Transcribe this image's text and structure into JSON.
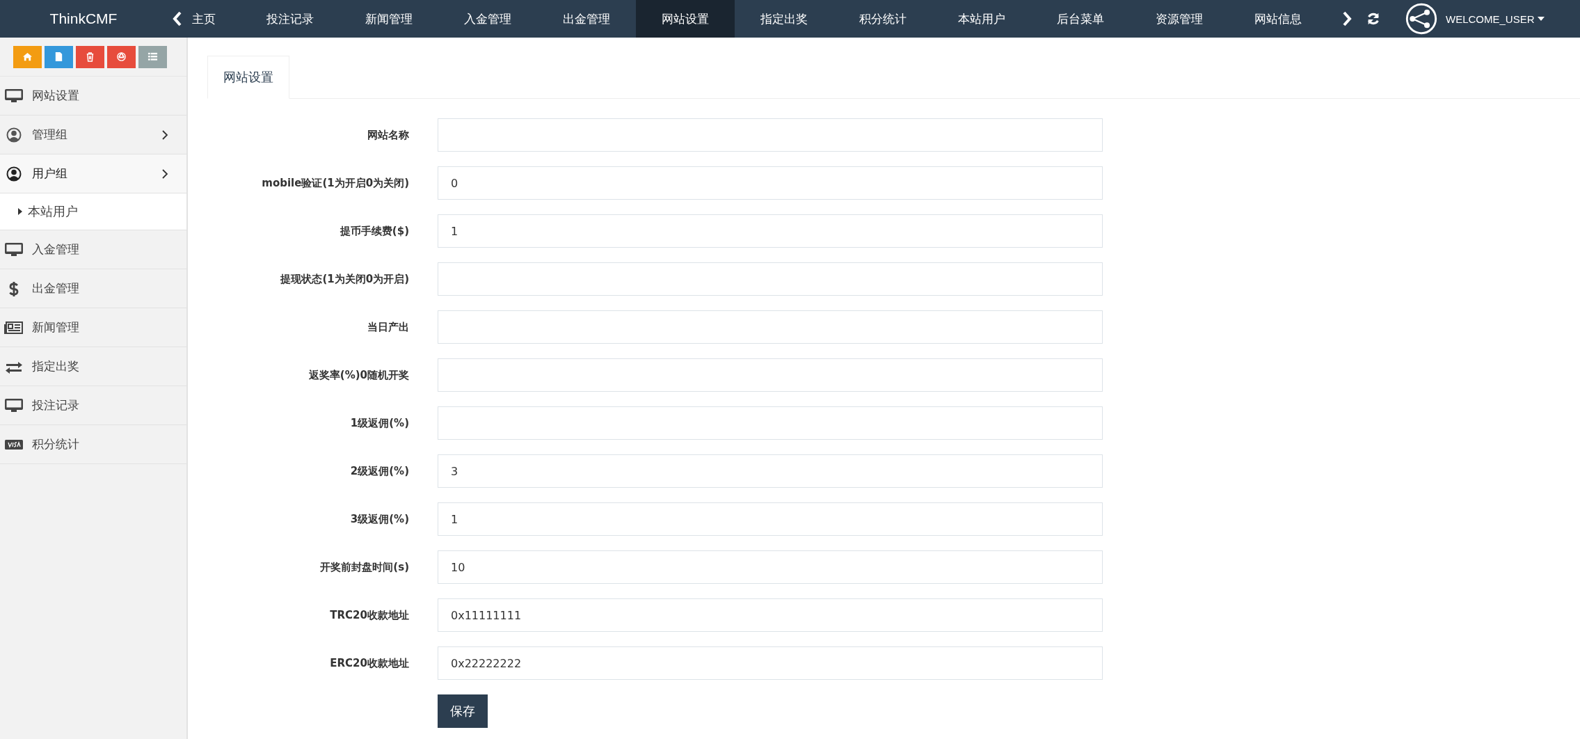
{
  "brand": "ThinkCMF",
  "nav": [
    {
      "label": "主页",
      "selected": false
    },
    {
      "label": "投注记录",
      "selected": false
    },
    {
      "label": "新闻管理",
      "selected": false
    },
    {
      "label": "入金管理",
      "selected": false
    },
    {
      "label": "出金管理",
      "selected": false
    },
    {
      "label": "网站设置",
      "selected": true
    },
    {
      "label": "指定出奖",
      "selected": false
    },
    {
      "label": "积分统计",
      "selected": false
    },
    {
      "label": "本站用户",
      "selected": false
    },
    {
      "label": "后台菜单",
      "selected": false
    },
    {
      "label": "资源管理",
      "selected": false
    },
    {
      "label": "网站信息",
      "selected": false
    }
  ],
  "user_menu": "WELCOME_USER",
  "sidebar": {
    "items": [
      {
        "label": "网站设置"
      },
      {
        "label": "管理组",
        "expanded": false
      },
      {
        "label": "用户组",
        "expanded": true,
        "children": [
          {
            "label": "本站用户",
            "selected": true
          }
        ]
      },
      {
        "label": "入金管理"
      },
      {
        "label": "出金管理"
      },
      {
        "label": "新闻管理"
      },
      {
        "label": "指定出奖"
      },
      {
        "label": "投注记录"
      },
      {
        "label": "积分统计"
      }
    ]
  },
  "tabs": [
    {
      "label": "网站设置",
      "selected": true
    }
  ],
  "form": {
    "fields": [
      {
        "label": "网站名称"
      },
      {
        "label": "mobile验证(1为开启0为关闭)",
        "value": "0"
      },
      {
        "label": "提币手续费($)",
        "value": "1"
      },
      {
        "label": "提现状态(1为关闭0为开启)"
      },
      {
        "label": "当日产出"
      },
      {
        "label": "返奖率(%)0随机开奖"
      },
      {
        "label": "1级返佣(%)"
      },
      {
        "label": "2级返佣(%)",
        "value": "3"
      },
      {
        "label": "3级返佣(%)",
        "value": "1"
      },
      {
        "label": "开奖前封盘时间(s)",
        "value": "10"
      },
      {
        "label": "TRC20收款地址",
        "value": "0x11111111"
      },
      {
        "label": "ERC20收款地址",
        "value": "0x22222222"
      }
    ],
    "save_button": "保存"
  }
}
